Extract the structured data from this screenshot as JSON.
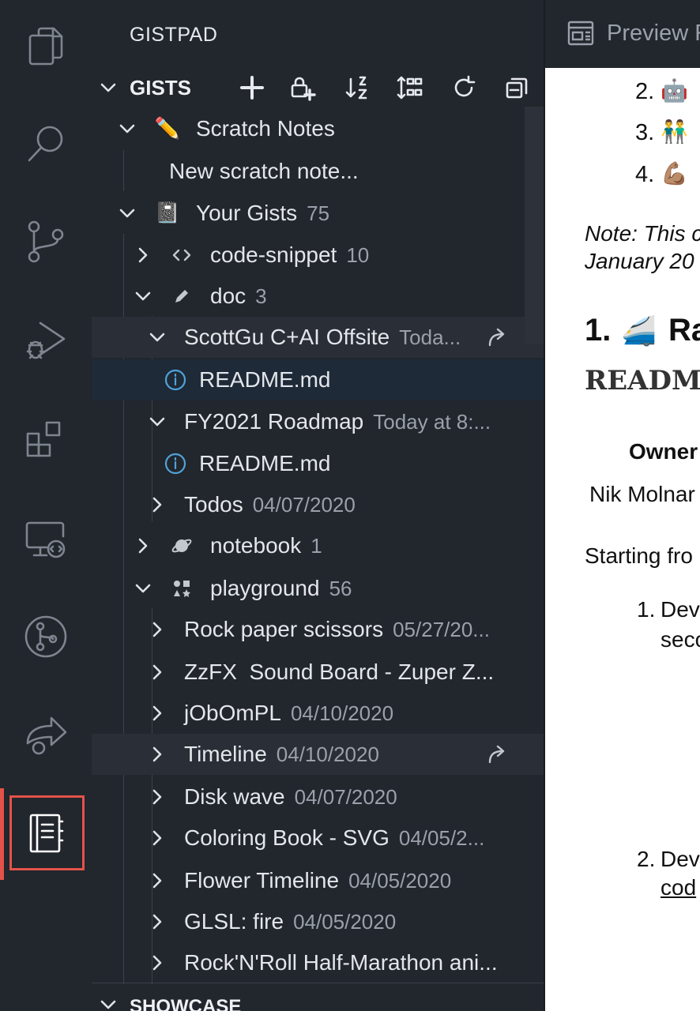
{
  "activity_bar": {
    "items": [
      "explorer-icon",
      "search-icon",
      "source-control-icon",
      "run-debug-icon",
      "extensions-icon",
      "remote-explorer-icon",
      "pull-requests-icon",
      "live-share-icon",
      "gistpad-notebook-icon"
    ],
    "active": "gistpad-notebook-icon",
    "highlight_color": "#e4524a"
  },
  "sidebar": {
    "title": "GISTPAD",
    "section": {
      "title": "GISTS",
      "toolbar": [
        "add-icon",
        "add-private-gist-icon",
        "sort-icon",
        "group-icon",
        "refresh-icon",
        "collapse-all-icon"
      ]
    },
    "tree": {
      "scratch_notes": {
        "label": "Scratch Notes",
        "icon": "✏️"
      },
      "new_scratch_note": {
        "label": "New scratch note..."
      },
      "your_gists": {
        "label": "Your Gists",
        "count": "75",
        "icon": "📓"
      },
      "code_snippet": {
        "label": "code-snippet",
        "count": "10"
      },
      "doc": {
        "label": "doc",
        "count": "3"
      },
      "scottgu": {
        "label": "ScottGu C+AI Offsite",
        "date": "Toda..."
      },
      "readme_1": {
        "label": "README.md"
      },
      "fy2021": {
        "label": "FY2021 Roadmap",
        "date": "Today at 8:..."
      },
      "readme_2": {
        "label": "README.md"
      },
      "todos": {
        "label": "Todos",
        "date": "04/07/2020"
      },
      "notebook": {
        "label": "notebook",
        "count": "1"
      },
      "playground": {
        "label": "playground",
        "count": "56"
      },
      "rock_paper": {
        "label": "Rock paper scissors",
        "date": "05/27/20..."
      },
      "zzfx": {
        "label": "ZzFX  Sound Board - Zuper Z..."
      },
      "jobompl": {
        "label": "jObOmPL",
        "date": "04/10/2020"
      },
      "timeline": {
        "label": "Timeline",
        "date": "04/10/2020"
      },
      "disk_wave": {
        "label": "Disk wave",
        "date": "04/07/2020"
      },
      "coloring_book": {
        "label": "Coloring Book - SVG",
        "date": "04/05/2..."
      },
      "flower_timeline": {
        "label": "Flower Timeline",
        "date": "04/05/2020"
      },
      "glsl_fire": {
        "label": "GLSL: fire",
        "date": "04/05/2020"
      },
      "rocknroll": {
        "label": "Rock'N'Roll Half-Marathon ani..."
      }
    },
    "showcase": {
      "title": "SHOWCASE"
    }
  },
  "editor": {
    "tab_title": "Preview R",
    "preview": {
      "list_top": [
        {
          "num": "2.",
          "emoji": "🤖"
        },
        {
          "num": "3.",
          "emoji": "👬"
        },
        {
          "num": "4.",
          "emoji": "💪🏽"
        }
      ],
      "note_line1": "Note: This c",
      "note_line2": "January 20",
      "heading_num": "1.",
      "heading_emoji": "🚄",
      "heading_text": "Ra",
      "code_heading": "README",
      "owner": "Owner",
      "owner_name": "Nik Molnar",
      "starting": "Starting fro",
      "list_item_1_num": "1.",
      "list_item_1_text": "Dev",
      "list_item_1_cont": "seco",
      "list_item_2_num": "2.",
      "list_item_2_text": "Dev",
      "list_item_2_link": "cod"
    }
  }
}
